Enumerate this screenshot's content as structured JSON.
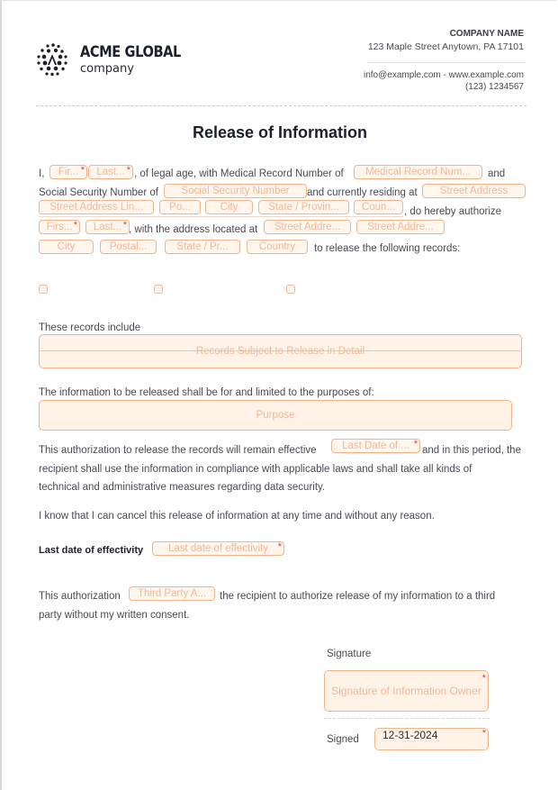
{
  "header": {
    "brand_name": "ACME GLOBAL",
    "brand_sub": "company",
    "company_name": "COMPANY NAME",
    "company_address": "123 Maple Street Anytown, PA 17101",
    "company_contact": "info@example.com - www.example.com",
    "company_phone": "(123) 1234567"
  },
  "title": "Release of Information",
  "paragraph1": {
    "t_i": "I,",
    "t_legal": ", of legal age, with Medical Record Number of",
    "t_and": "and",
    "t_ssn": "Social Security Number of",
    "t_residing": "and currently residing at",
    "t_authorize": ", do hereby authorize",
    "t_address": ", with the address located at",
    "t_release": "to release the following records:",
    "fields": {
      "first_name": "Fir...",
      "last_name": "Last...",
      "medical_record": "Medical Record Num...",
      "ssn": "Social Security Number",
      "street_address": "Street Address",
      "street_line2": "Street Address Lin...",
      "postal": "Po...",
      "city": "City",
      "state": "State / Provin...",
      "country": "Coun...",
      "auth_first": "Firs...",
      "auth_last": "Last...",
      "auth_street": "Street Addre...",
      "auth_street2": "Street Addre...",
      "auth_city": "City",
      "auth_postal": "Postal...",
      "auth_state": "State / Pr...",
      "auth_country": "Country"
    }
  },
  "checkboxes": [
    false,
    false,
    false
  ],
  "records": {
    "label": "These records include",
    "placeholder": "Records Subject to Release in Detail"
  },
  "purpose": {
    "label": "The information to be released shall be for and limited to the purposes of:",
    "placeholder": "Purpose"
  },
  "effective": {
    "t1": "This authorization to release the records will remain effective",
    "field": "Last Date of ...",
    "t2": "and in this period, the",
    "t3": "recipient shall use the information in compliance with applicable laws and shall take all kinds of",
    "t4": "technical and administrative measures regarding data security."
  },
  "cancel_text": "I know that I can cancel this release of information at any time and without any reason.",
  "last_date": {
    "label": "Last date of effectivity",
    "placeholder": "Last date of effectivity"
  },
  "third_party": {
    "t1": "This authorization",
    "field": "Third Party A...",
    "t2": "the recipient to authorize release of my information to a third",
    "t3": "party without my written consent."
  },
  "signature": {
    "label": "Signature",
    "placeholder": "Signature of Information Owner",
    "signed_label": "Signed",
    "signed_value": "12-31-2024"
  },
  "required_mark": "*",
  "colors": {
    "field_border": "#f2b48a",
    "field_bg": "#fff6ee",
    "placeholder": "#f4b795",
    "required": "#e0413a",
    "heading": "#1d1f2b"
  }
}
